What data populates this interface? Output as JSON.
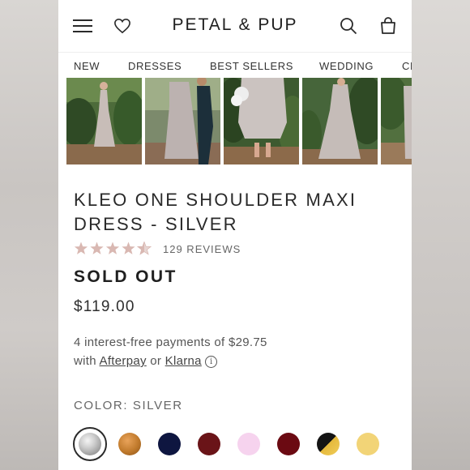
{
  "header": {
    "brand": "PETAL & PUP",
    "icons": [
      "menu-icon",
      "heart-icon",
      "search-icon",
      "bag-icon"
    ]
  },
  "nav": {
    "items": [
      "NEW",
      "DRESSES",
      "BEST SELLERS",
      "WEDDING",
      "CL"
    ]
  },
  "gallery": {
    "thumbnails": [
      "product-photo-1",
      "product-photo-2",
      "product-photo-3",
      "product-photo-4",
      "product-photo-5"
    ]
  },
  "product": {
    "title": "KLEO ONE SHOULDER MAXI DRESS - SILVER",
    "rating": 4.5,
    "rating_max": 5,
    "reviews": "129 REVIEWS",
    "status": "SOLD OUT",
    "price": "$119.00"
  },
  "payment": {
    "line1": "4 interest-free payments of $29.75",
    "with": "with",
    "afterpay": "Afterpay",
    "or": "or",
    "klarna": "Klarna",
    "info_glyph": "i"
  },
  "color": {
    "label": "COLOR: SILVER",
    "swatches": [
      {
        "name": "silver",
        "color": "#b9b9b9",
        "selected": true
      },
      {
        "name": "bronze",
        "color": "#c07a2c",
        "selected": false
      },
      {
        "name": "navy",
        "color": "#0e1640",
        "selected": false
      },
      {
        "name": "burgundy",
        "color": "#6a1418",
        "selected": false
      },
      {
        "name": "pink",
        "color": "#f6d3ee",
        "selected": false
      },
      {
        "name": "wine",
        "color": "#6b0a12",
        "selected": false
      },
      {
        "name": "black-gold",
        "color": "#141414",
        "selected": false
      },
      {
        "name": "yellow",
        "color": "#f2d477",
        "selected": false
      }
    ]
  },
  "colors": {
    "star_filled": "#d9b8b2",
    "star_empty": "#e7d6d3"
  }
}
